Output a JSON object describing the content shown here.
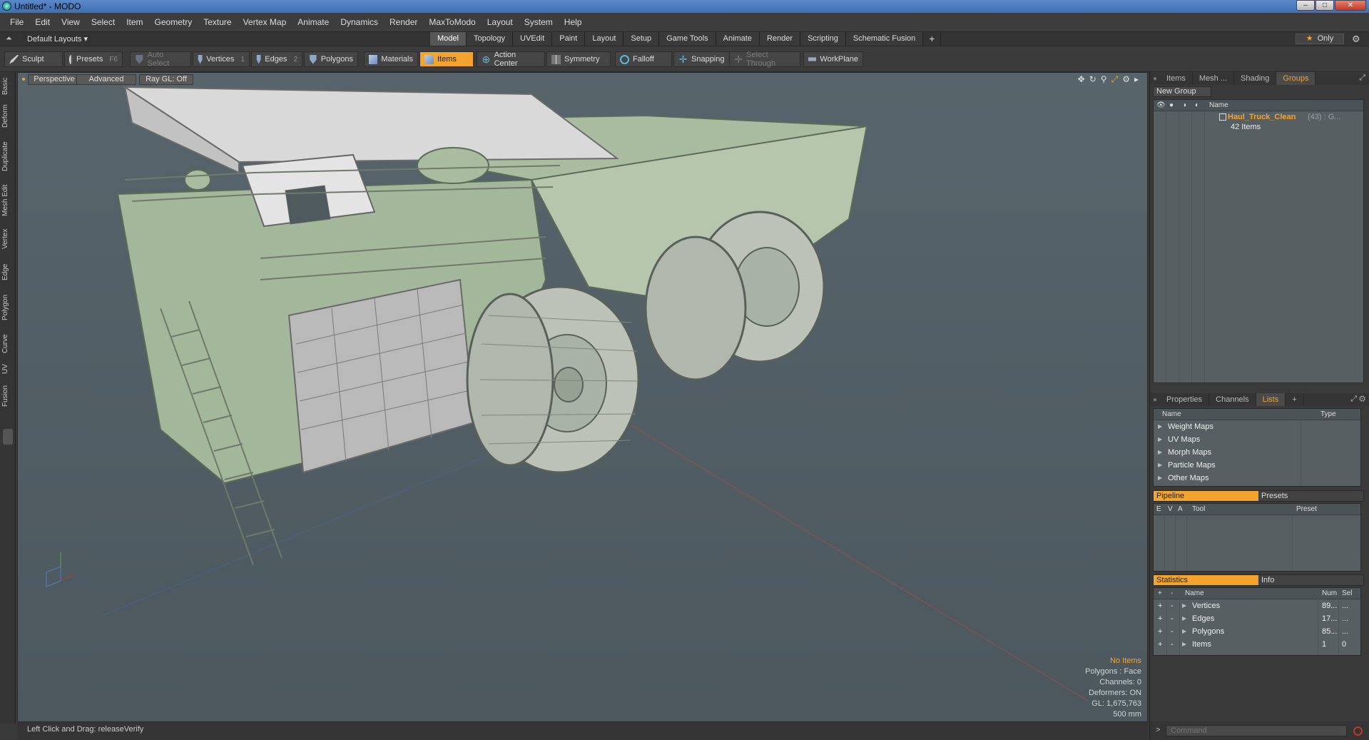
{
  "window": {
    "title": "Untitled* - MODO",
    "buttons": {
      "minimize": "–",
      "maximize": "□",
      "close": "✕"
    }
  },
  "menu": [
    "File",
    "Edit",
    "View",
    "Select",
    "Item",
    "Geometry",
    "Texture",
    "Vertex Map",
    "Animate",
    "Dynamics",
    "Render",
    "MaxToModo",
    "Layout",
    "System",
    "Help"
  ],
  "layoutbar": {
    "layout_name": "Default Layouts ▾",
    "tabs": [
      "Model",
      "Topology",
      "UVEdit",
      "Paint",
      "Layout",
      "Setup",
      "Game Tools",
      "Animate",
      "Render",
      "Scripting",
      "Schematic Fusion"
    ],
    "active_tab": "Model",
    "add_tab": "+",
    "only_label": "Only"
  },
  "toolbar": {
    "sculpt": "Sculpt",
    "presets": "Presets",
    "presets_key": "F6",
    "auto_select": "Auto Select",
    "vertices": "Vertices",
    "vertices_key": "1",
    "edges": "Edges",
    "edges_key": "2",
    "polygons": "Polygons",
    "materials": "Materials",
    "items": "Items",
    "action_center": "Action Center",
    "symmetry": "Symmetry",
    "falloff": "Falloff",
    "snapping": "Snapping",
    "select_through": "Select Through",
    "workplane": "WorkPlane"
  },
  "left_tabs": [
    "Basic",
    "Deform",
    "Duplicate",
    "Mesh Edit",
    "Vertex",
    "Edge",
    "Polygon",
    "Curve",
    "UV",
    "Fusion"
  ],
  "viewport": {
    "view_mode": "Perspective",
    "shading": "Advanced",
    "raygl": "Ray GL: Off",
    "info": {
      "no_items": "No Items",
      "polygons": "Polygons : Face",
      "channels": "Channels: 0",
      "deformers": "Deformers: ON",
      "gl": "GL: 1,675,763",
      "scale": "500 mm"
    }
  },
  "status": {
    "message": "Left Click and Drag:   releaseVerify"
  },
  "right_panel": {
    "top_tabs": [
      "Items",
      "Mesh ...",
      "Shading",
      "Groups"
    ],
    "top_active": "Groups",
    "new_group": "New Group",
    "groups_header_name": "Name",
    "group": {
      "name": "Haul_Truck_Clean",
      "count": "(43) : G...",
      "sub": "42 Items"
    },
    "mid_tabs": [
      "Properties",
      "Channels",
      "Lists"
    ],
    "mid_active": "Lists",
    "mid_add": "+",
    "lists_header": {
      "name": "Name",
      "type": "Type"
    },
    "lists_items": [
      "Weight Maps",
      "UV Maps",
      "Morph Maps",
      "Particle Maps",
      "Other Maps"
    ],
    "pipeline": {
      "tab_active": "Pipeline",
      "tab_other": "Presets",
      "cols": [
        "E",
        "V",
        "A",
        "Tool",
        "Preset"
      ]
    },
    "statistics": {
      "tab_active": "Statistics",
      "tab_other": "Info",
      "cols": {
        "add": "+",
        "sub": "-",
        "name": "Name",
        "num": "Num",
        "sel": "Sel"
      },
      "rows": [
        {
          "name": "Vertices",
          "num": "89...",
          "sel": "..."
        },
        {
          "name": "Edges",
          "num": "17...",
          "sel": "..."
        },
        {
          "name": "Polygons",
          "num": "85...",
          "sel": "..."
        },
        {
          "name": "Items",
          "num": "1",
          "sel": "0"
        }
      ]
    },
    "command_placeholder": "Command",
    "command_prompt": ">"
  },
  "colors": {
    "accent": "#f3a42c",
    "viewport_bg": "#57646b",
    "model_fill": "#a9bca0",
    "model_edge": "#5c6a58"
  }
}
